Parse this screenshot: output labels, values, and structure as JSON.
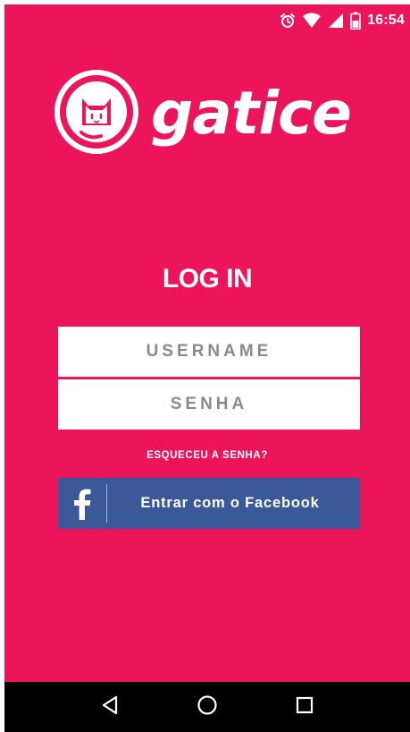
{
  "status_bar": {
    "time": "16:54",
    "icons": [
      "alarm-icon",
      "wifi-icon",
      "signal-icon",
      "battery-icon"
    ]
  },
  "logo": {
    "wordmark": "gatice",
    "icon": "cat-logo-icon"
  },
  "login": {
    "title": "LOG IN",
    "username_placeholder": "USERNAME",
    "password_placeholder": "SENHA",
    "forgot_password": "ESQUECEU A SENHA?",
    "facebook_button": "Entrar com o Facebook",
    "facebook_icon": "facebook-icon"
  },
  "nav_bar": {
    "buttons": [
      "back-icon",
      "home-icon",
      "recents-icon"
    ]
  },
  "colors": {
    "background": "#ec1559",
    "facebook": "#3b5998",
    "field_text": "#8a8a8a",
    "white": "#ffffff",
    "navbar": "#000000"
  }
}
